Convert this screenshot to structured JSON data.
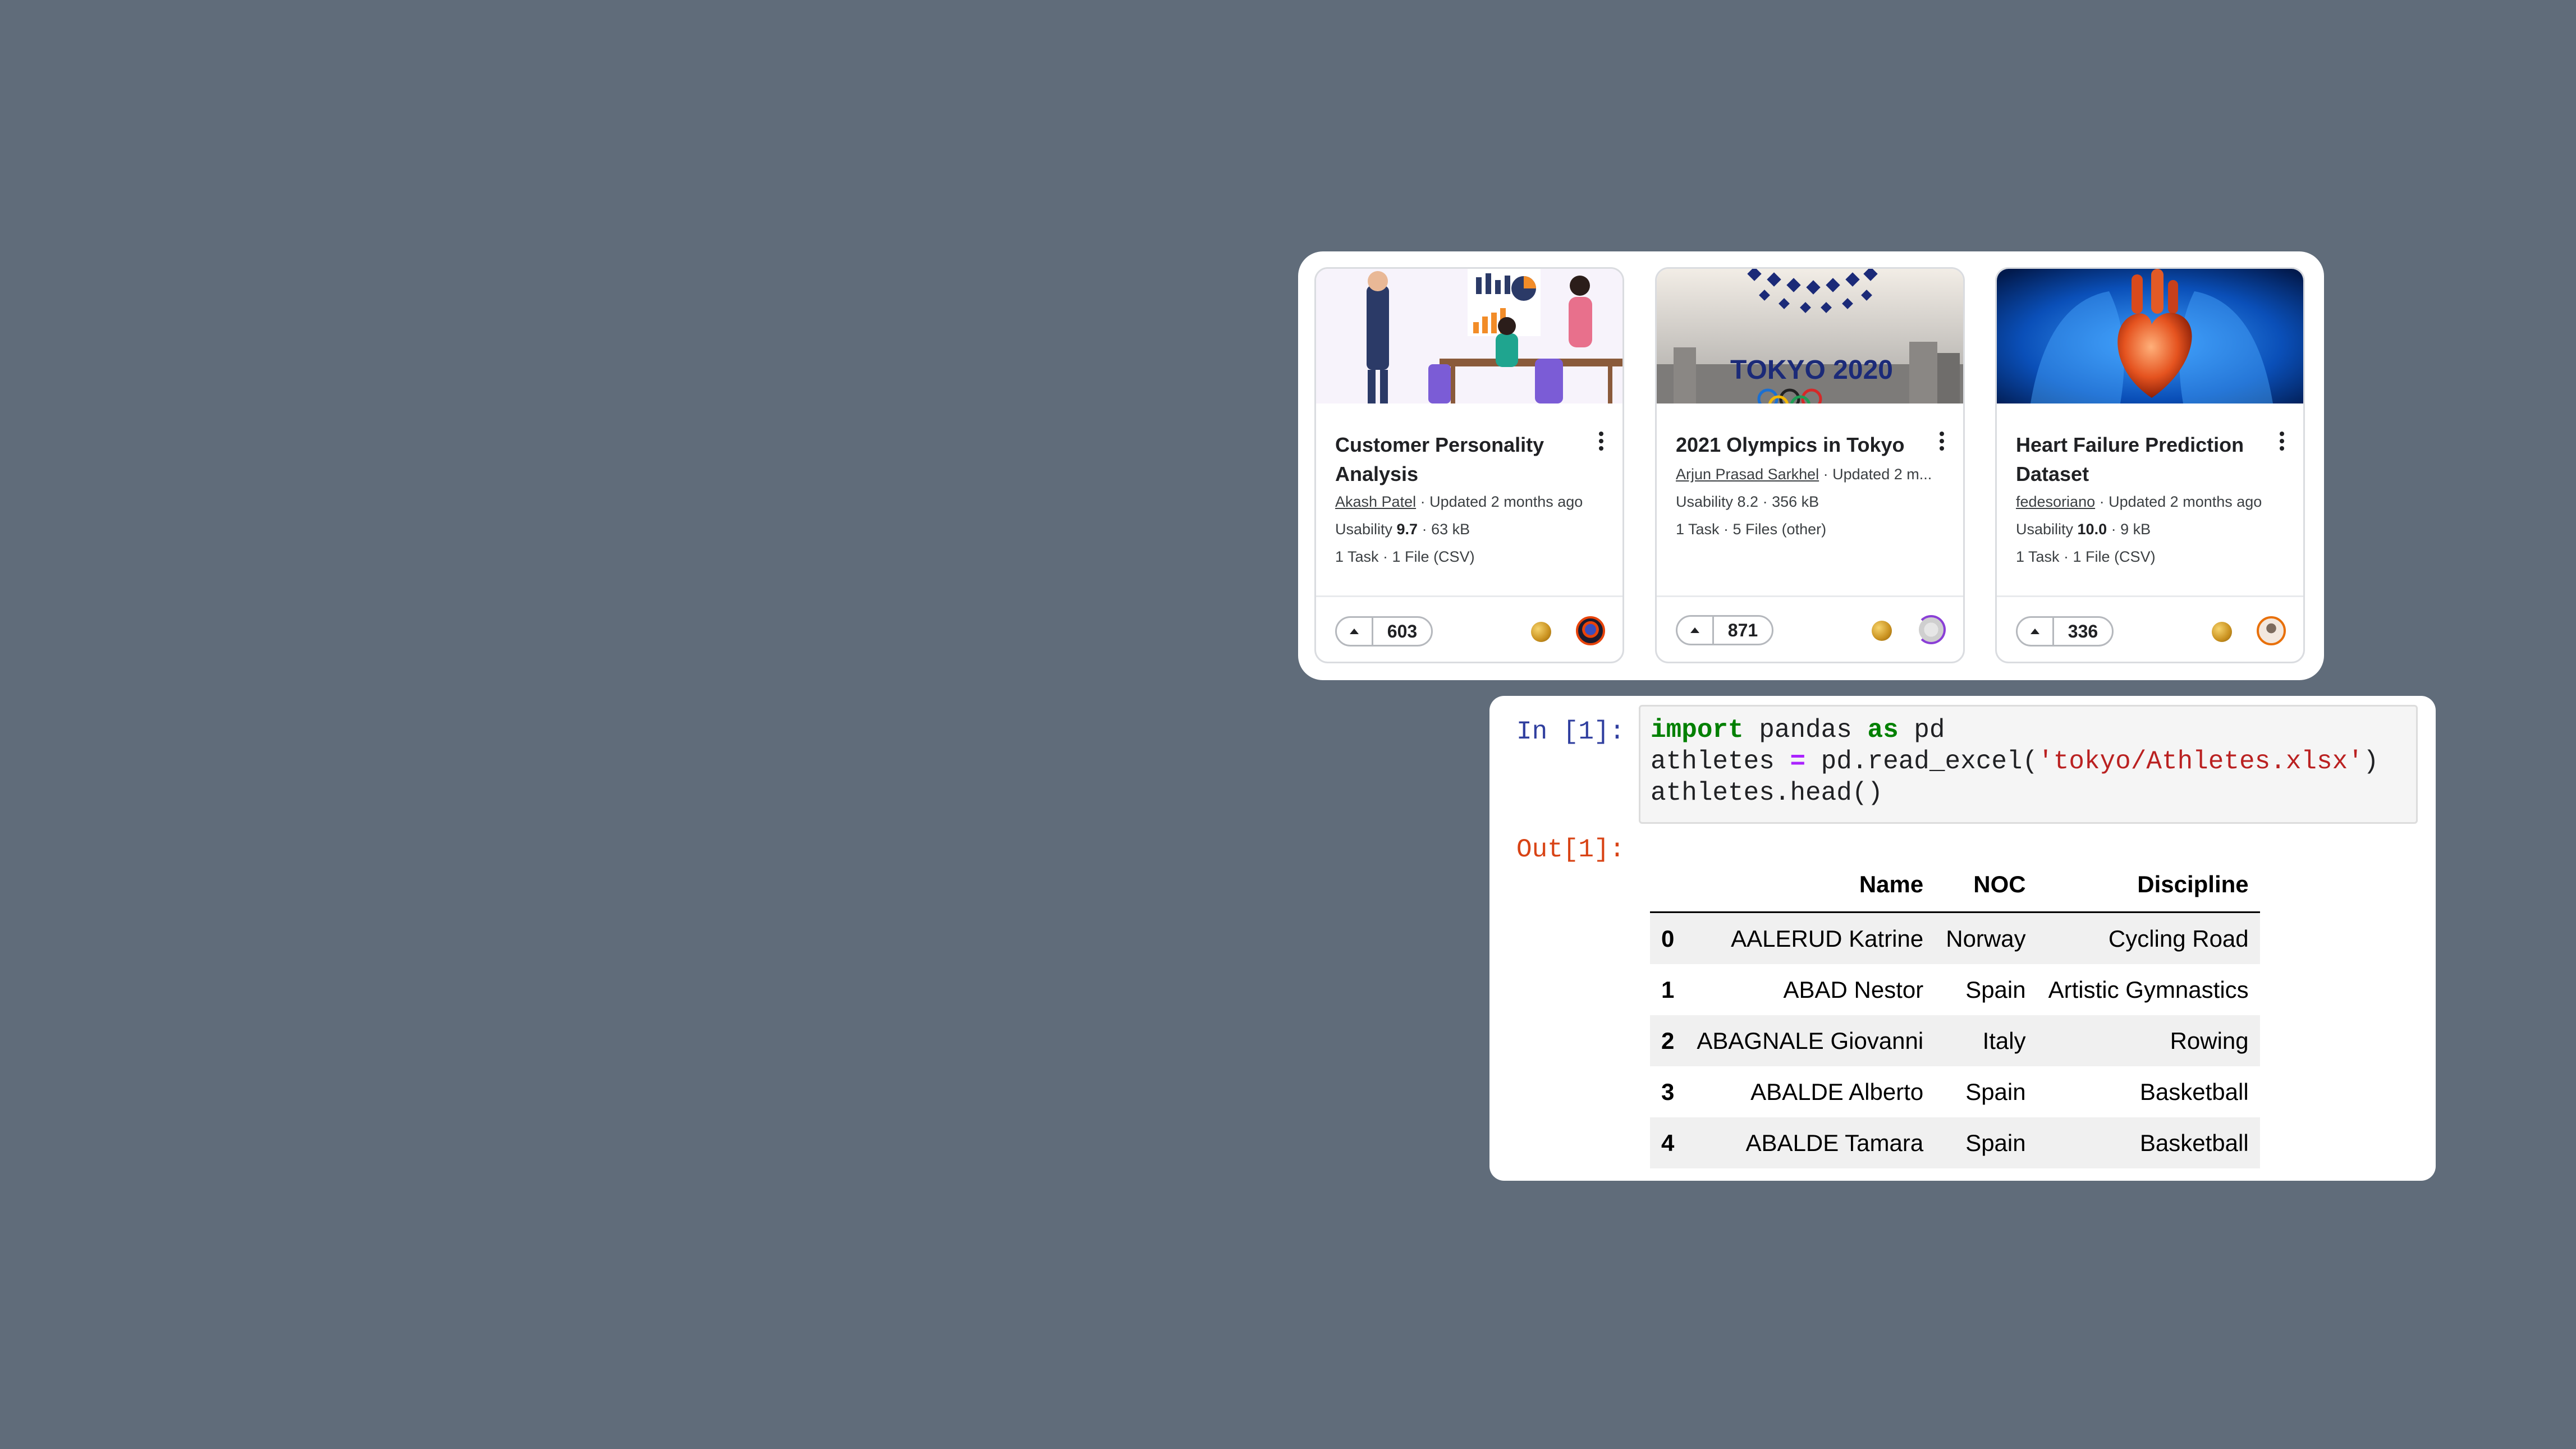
{
  "cards": [
    {
      "title": "Customer Personality Analysis",
      "author": "Akash Patel",
      "updated": " · Updated 2 months ago",
      "usability_label": "Usability ",
      "usability": "9.7",
      "size": " · 63 kB",
      "files": "1 Task · 1 File (CSV)",
      "votes": "603",
      "image_icon": "business-presentation-illustration"
    },
    {
      "title": "2021 Olympics in Tokyo",
      "author": "Arjun Prasad Sarkhel",
      "updated": " · Updated 2 m...",
      "usability_label": "Usability 8.2",
      "usability": "",
      "size": " · 356 kB",
      "files": "1 Task · 5 Files (other)",
      "votes": "871",
      "image_icon": "tokyo-2020-emblem",
      "image_text": "TOKYO 2020"
    },
    {
      "title": "Heart Failure Prediction Dataset",
      "author": "fedesoriano",
      "updated": " · Updated 2 months ago",
      "usability_label": "Usability ",
      "usability": "10.0",
      "size": " · 9 kB",
      "files": "1 Task · 1 File (CSV)",
      "votes": "336",
      "image_icon": "anatomical-heart-illustration"
    }
  ],
  "notebook": {
    "in_prompt": "In [1]:",
    "out_prompt": "Out[1]:",
    "code": {
      "l1_kw1": "import",
      "l1_mid": " pandas ",
      "l1_kw2": "as",
      "l1_end": " pd",
      "l2_a": "athletes ",
      "l2_op": "=",
      "l2_b": " pd.read_excel(",
      "l2_str": "'tokyo/Athletes.xlsx'",
      "l2_c": ")",
      "l3": "athletes.head()"
    },
    "table": {
      "headers": [
        "",
        "Name",
        "NOC",
        "Discipline"
      ],
      "rows": [
        {
          "idx": "0",
          "name": "AALERUD Katrine",
          "noc": "Norway",
          "discipline": "Cycling Road"
        },
        {
          "idx": "1",
          "name": "ABAD Nestor",
          "noc": "Spain",
          "discipline": "Artistic Gymnastics"
        },
        {
          "idx": "2",
          "name": "ABAGNALE Giovanni",
          "noc": "Italy",
          "discipline": "Rowing"
        },
        {
          "idx": "3",
          "name": "ABALDE Alberto",
          "noc": "Spain",
          "discipline": "Basketball"
        },
        {
          "idx": "4",
          "name": "ABALDE Tamara",
          "noc": "Spain",
          "discipline": "Basketball"
        }
      ]
    }
  },
  "colors": {
    "background": "#606c7a",
    "keyword": "#008000",
    "string": "#ba2121",
    "in_prompt": "#303f9f",
    "out_prompt": "#d84315"
  }
}
